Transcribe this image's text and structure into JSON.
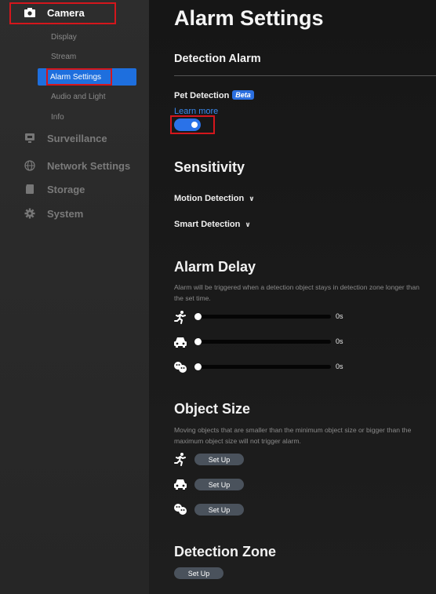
{
  "sidebar": {
    "items": [
      {
        "label": "Camera",
        "icon": "camera-icon"
      },
      {
        "label": "Surveillance",
        "icon": "monitor-icon"
      },
      {
        "label": "Network Settings",
        "icon": "globe-icon"
      },
      {
        "label": "Storage",
        "icon": "storage-icon"
      },
      {
        "label": "System",
        "icon": "gear-icon"
      }
    ],
    "subitems": [
      "Display",
      "Stream",
      "Alarm Settings",
      "Audio and Light",
      "Info"
    ]
  },
  "main": {
    "title": "Alarm Settings",
    "detection_alarm": {
      "heading": "Detection Alarm",
      "pet_label": "Pet Detection",
      "beta": "Beta",
      "learn_more": "Learn more",
      "toggle_on": true
    },
    "sensitivity": {
      "heading": "Sensitivity",
      "motion": "Motion Detection",
      "smart": "Smart Detection"
    },
    "alarm_delay": {
      "heading": "Alarm Delay",
      "desc": "Alarm will be triggered when a detection object stays in detection zone longer than the set time.",
      "rows": [
        {
          "icon": "person-running-icon",
          "value": "0s"
        },
        {
          "icon": "car-icon",
          "value": "0s"
        },
        {
          "icon": "pet-icon",
          "value": "0s"
        }
      ]
    },
    "object_size": {
      "heading": "Object Size",
      "desc": "Moving objects that are smaller than the minimum object size or bigger than the maximum object size will not trigger alarm.",
      "button": "Set Up"
    },
    "detection_zone": {
      "heading": "Detection Zone",
      "button": "Set Up"
    }
  },
  "colors": {
    "accent": "#1e6fde",
    "highlight": "#d4161c"
  }
}
